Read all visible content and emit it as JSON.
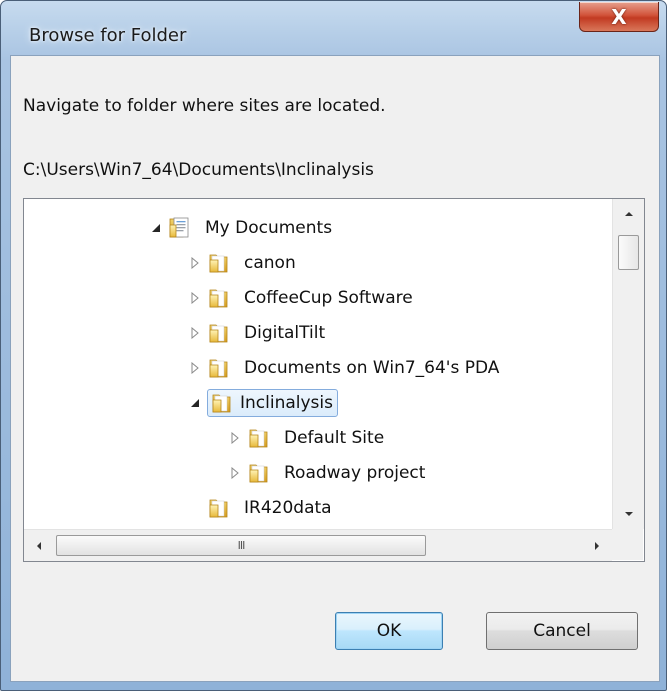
{
  "window": {
    "title": "Browse for Folder",
    "close_glyph": "X"
  },
  "dialog": {
    "instruction": "Navigate to folder where sites are located.",
    "current_path": "C:\\Users\\Win7_64\\Documents\\Inclinalysis"
  },
  "tree": {
    "items": [
      {
        "label": "My Documents",
        "icon": "documents-library-icon",
        "expander": "expanded"
      },
      {
        "label": "canon",
        "icon": "folder-icon",
        "expander": "collapsed"
      },
      {
        "label": "CoffeeCup Software",
        "icon": "folder-icon",
        "expander": "collapsed"
      },
      {
        "label": "DigitalTilt",
        "icon": "folder-icon",
        "expander": "collapsed"
      },
      {
        "label": "Documents on Win7_64's PDA",
        "icon": "folder-icon",
        "expander": "collapsed"
      },
      {
        "label": "Inclinalysis",
        "icon": "folder-icon",
        "expander": "expanded",
        "selected": true
      },
      {
        "label": "Default Site",
        "icon": "folder-icon",
        "expander": "collapsed"
      },
      {
        "label": "Roadway project",
        "icon": "folder-icon",
        "expander": "collapsed"
      },
      {
        "label": "IR420data",
        "icon": "folder-icon",
        "expander": "none"
      }
    ],
    "hscroll_grip": "III"
  },
  "buttons": {
    "ok_label": "OK",
    "cancel_label": "Cancel"
  },
  "colors": {
    "selection_border": "#84acdd",
    "default_button_border": "#3c7fb1",
    "close_button": "#c23a22"
  }
}
